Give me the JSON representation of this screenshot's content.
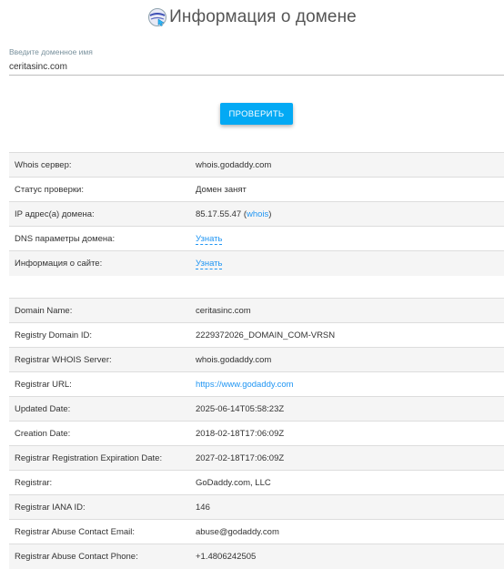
{
  "header": {
    "title": "Информация о домене",
    "logo_icon": "globe-magnifier-icon"
  },
  "input": {
    "label": "Введите доменное имя",
    "value": "ceritasinc.com"
  },
  "check_button": {
    "label": "ПРОВЕРИТЬ",
    "color": "#03a9f4"
  },
  "summary": {
    "whois_server": {
      "key": "Whois сервер:",
      "value": "whois.godaddy.com"
    },
    "status": {
      "key": "Статус проверки:",
      "value": "Домен занят"
    },
    "ip": {
      "key": "IP адрес(а) домена:",
      "value": "85.17.55.47",
      "open": " (",
      "link": "whois",
      "close": ")"
    },
    "dns": {
      "key": "DNS параметры домена:",
      "link": "Узнать"
    },
    "site_info": {
      "key": "Информация о сайте:",
      "link": "Узнать"
    }
  },
  "details": {
    "domain_name": {
      "key": "Domain Name:",
      "value": "ceritasinc.com"
    },
    "registry_domain_id": {
      "key": "Registry Domain ID:",
      "value": "2229372026_DOMAIN_COM-VRSN"
    },
    "registrar_whois_server": {
      "key": "Registrar WHOIS Server:",
      "value": "whois.godaddy.com"
    },
    "registrar_url": {
      "key": "Registrar URL:",
      "value": "https://www.godaddy.com"
    },
    "updated_date": {
      "key": "Updated Date:",
      "value": "2025-06-14T05:58:23Z"
    },
    "creation_date": {
      "key": "Creation Date:",
      "value": "2018-02-18T17:06:09Z"
    },
    "expiration_date": {
      "key": "Registrar Registration Expiration Date:",
      "value": "2027-02-18T17:06:09Z"
    },
    "registrar": {
      "key": "Registrar:",
      "value": "GoDaddy.com, LLC"
    },
    "iana_id": {
      "key": "Registrar IANA ID:",
      "value": "146"
    },
    "abuse_email": {
      "key": "Registrar Abuse Contact Email:",
      "value": "abuse@godaddy.com"
    },
    "abuse_phone": {
      "key": "Registrar Abuse Contact Phone:",
      "value": "+1.4806242505"
    }
  }
}
